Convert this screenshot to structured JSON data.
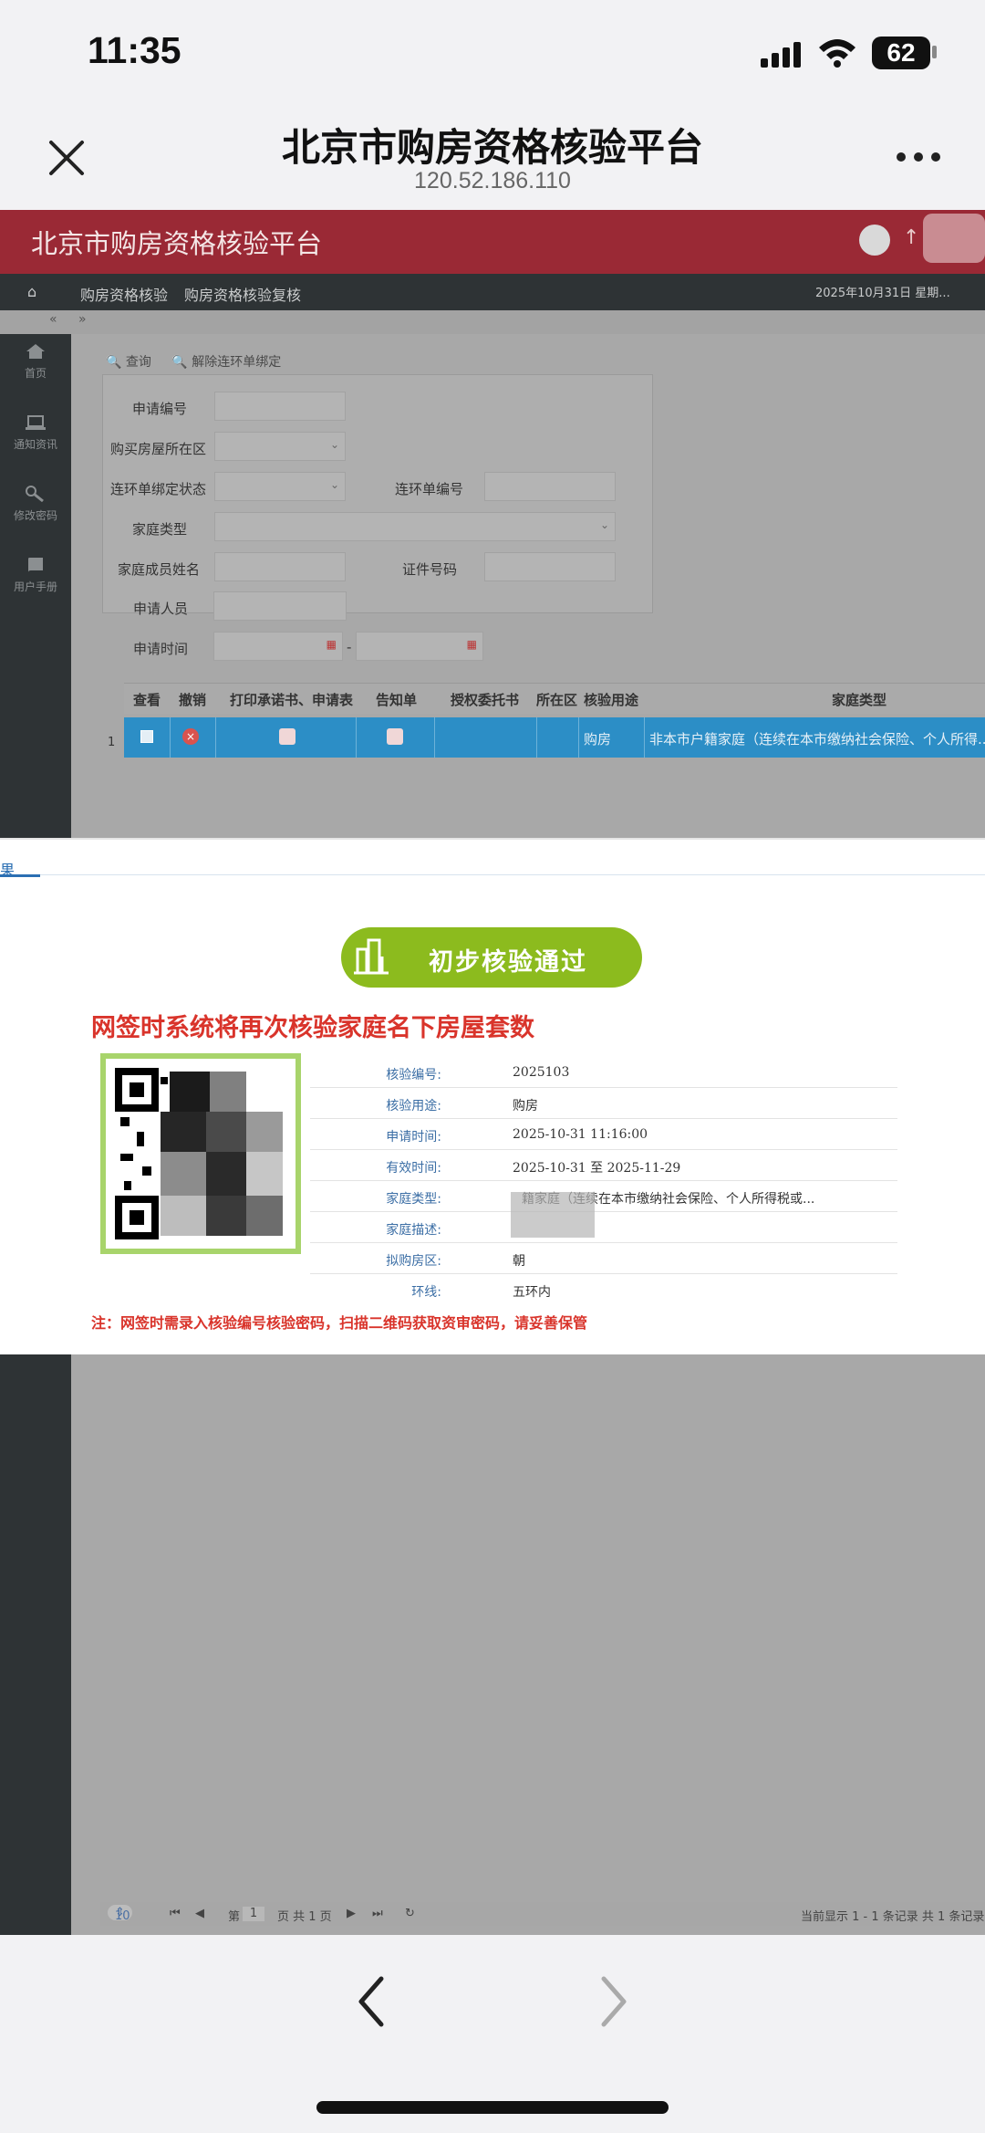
{
  "status_bar": {
    "time": "11:35",
    "battery": "62"
  },
  "browser": {
    "title": "北京市购房资格核验平台",
    "url": "120.52.186.110"
  },
  "site": {
    "title": "北京市购房资格核验平台",
    "menu": [
      "购房资格核验",
      "购房资格核验复核"
    ],
    "date_text": "2025年10月31日 星期..."
  },
  "sidebar": {
    "items": [
      "首页",
      "通知资讯",
      "修改密码",
      "用户手册"
    ]
  },
  "toolbar": {
    "query": "查询",
    "unbind": "解除连环单绑定"
  },
  "form": {
    "application_no": "申请编号",
    "district": "购买房屋所在区",
    "bind_status": "连环单绑定状态",
    "chain_no": "连环单编号",
    "family_type": "家庭类型",
    "member_name": "家庭成员姓名",
    "id_no": "证件号码",
    "applicant": "申请人员",
    "apply_time": "申请时间",
    "dash": "-"
  },
  "grid": {
    "headers": [
      "查看",
      "撤销",
      "打印承诺书、申请表",
      "告知单",
      "授权委托书",
      "所在区",
      "核验用途",
      "家庭类型"
    ],
    "row": {
      "index": "1",
      "usage": "购房",
      "family_type": "非本市户籍家庭（连续在本市缴纳社会保险、个人所得..."
    }
  },
  "result": {
    "tab": "果",
    "pass_label": "初步核验通过",
    "warning": "网签时系统将再次核验家庭名下房屋套数",
    "rows": [
      {
        "key": "核验编号:",
        "value": "2025103"
      },
      {
        "key": "核验用途:",
        "value": "购房"
      },
      {
        "key": "申请时间:",
        "value": "2025-10-31 11:16:00"
      },
      {
        "key": "有效时间:",
        "value": "2025-10-31 至 2025-11-29"
      },
      {
        "key": "家庭类型:",
        "value": "籍家庭（连续在本市缴纳社会保险、个人所得税或..."
      },
      {
        "key": "家庭描述:",
        "value": ""
      },
      {
        "key": "拟购房区:",
        "value": "朝"
      },
      {
        "key": "环线:",
        "value": "五环内"
      }
    ],
    "note": "注：网签时需录入核验编号核验密码，扫描二维码获取资审密码，请妥善保管"
  },
  "pager": {
    "page_size": "10",
    "page_prefix": "第",
    "page_value": "1",
    "page_suffix": "页 共 1 页",
    "summary": "当前显示 1 - 1 条记录 共 1 条记录"
  }
}
